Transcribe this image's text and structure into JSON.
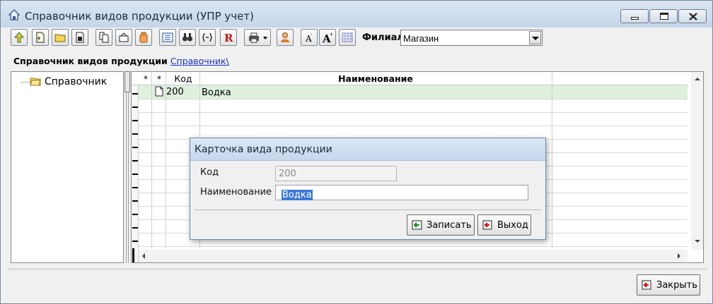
{
  "window": {
    "title": "Справочник видов продукции (УПР учет)",
    "controls": [
      "minimize",
      "maximize",
      "close"
    ]
  },
  "toolbar": {
    "buttons": [
      "up-arrow-icon",
      "new-document-icon",
      "folder-icon",
      "save-icon",
      "copy-icon",
      "open-icon",
      "delete-icon",
      "list-icon",
      "binoculars-icon",
      "brackets-icon",
      "r-icon",
      "printer-icon",
      "user-icon",
      "font-decrease-icon",
      "font-increase-icon",
      "calendar-icon"
    ],
    "branch_label": "Филиал",
    "branch_value": "Магазин"
  },
  "breadcrumb": {
    "title": "Справочник видов продукции",
    "link": "Справочник\\"
  },
  "tree": {
    "items": [
      {
        "label": "Справочник"
      }
    ]
  },
  "grid": {
    "columns": [
      "*",
      "*",
      "Код",
      "Наименование"
    ],
    "rows": [
      {
        "code": "200",
        "name": "Водка"
      }
    ]
  },
  "dialog": {
    "title": "Карточка вида продукции",
    "code_label": "Код",
    "code_value": "200",
    "name_label": "Наименование",
    "name_value": "Водка",
    "save_button": "Записать",
    "exit_button": "Выход"
  },
  "footer": {
    "close_button": "Закрыть"
  }
}
